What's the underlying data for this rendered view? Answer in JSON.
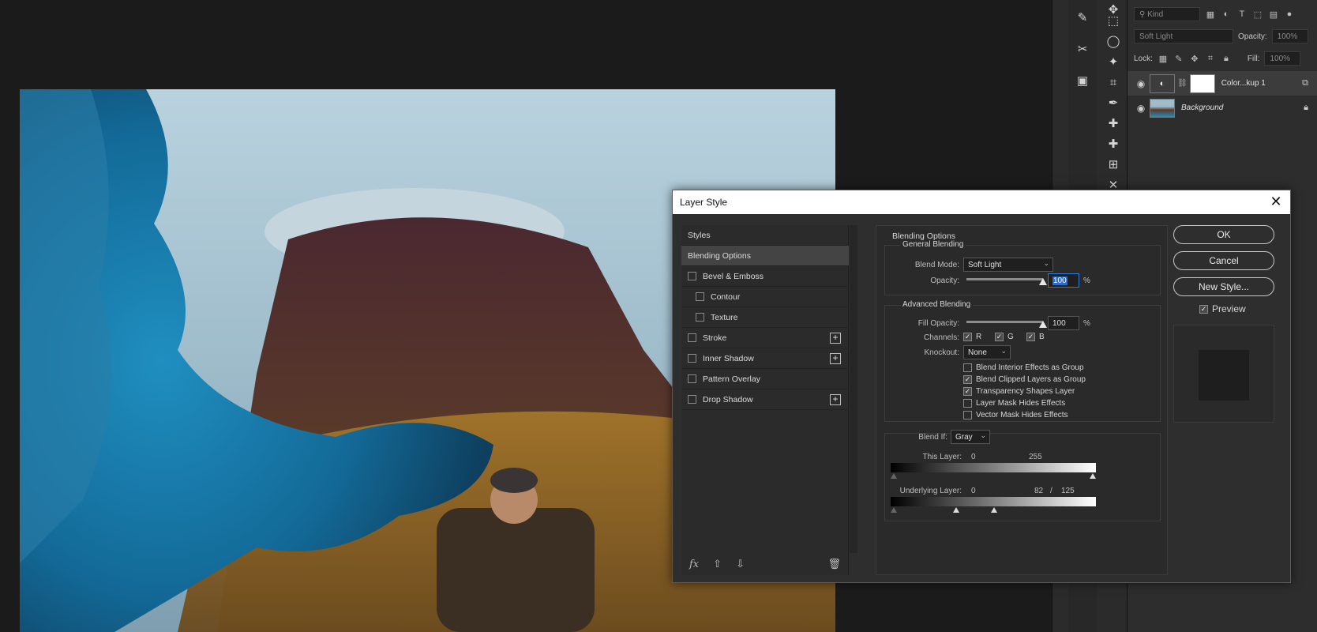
{
  "layers_panel": {
    "filter_kind": "Kind",
    "blend_mode": "Soft Light",
    "opacity_label": "Opacity:",
    "opacity_value": "100%",
    "lock_label": "Lock:",
    "fill_label": "Fill:",
    "fill_value": "100%",
    "layers": [
      {
        "name": "Color...kup 1",
        "selected": true
      },
      {
        "name": "Background",
        "selected": false
      }
    ]
  },
  "dialog": {
    "title": "Layer Style",
    "styles_list": [
      {
        "label": "Styles",
        "checkbox": false,
        "indent": false,
        "plus": false,
        "selected": false
      },
      {
        "label": "Blending Options",
        "checkbox": false,
        "indent": false,
        "plus": false,
        "selected": true
      },
      {
        "label": "Bevel & Emboss",
        "checkbox": true,
        "indent": false,
        "plus": false,
        "selected": false
      },
      {
        "label": "Contour",
        "checkbox": true,
        "indent": true,
        "plus": false,
        "selected": false
      },
      {
        "label": "Texture",
        "checkbox": true,
        "indent": true,
        "plus": false,
        "selected": false
      },
      {
        "label": "Stroke",
        "checkbox": true,
        "indent": false,
        "plus": true,
        "selected": false
      },
      {
        "label": "Inner Shadow",
        "checkbox": true,
        "indent": false,
        "plus": true,
        "selected": false
      },
      {
        "label": "Pattern Overlay",
        "checkbox": true,
        "indent": false,
        "plus": false,
        "selected": false
      },
      {
        "label": "Drop Shadow",
        "checkbox": true,
        "indent": false,
        "plus": true,
        "selected": false
      }
    ],
    "blending": {
      "section_title": "Blending Options",
      "general_title": "General Blending",
      "blend_mode_label": "Blend Mode:",
      "blend_mode_value": "Soft Light",
      "opacity_label": "Opacity:",
      "opacity_value": "100",
      "opacity_level": 1.0,
      "percent": "%",
      "advanced_title": "Advanced Blending",
      "fill_opacity_label": "Fill Opacity:",
      "fill_opacity_value": "100",
      "fill_opacity_level": 1.0,
      "channels_label": "Channels:",
      "channels": [
        {
          "label": "R",
          "checked": true
        },
        {
          "label": "G",
          "checked": true
        },
        {
          "label": "B",
          "checked": true
        }
      ],
      "knockout_label": "Knockout:",
      "knockout_value": "None",
      "options": [
        {
          "label": "Blend Interior Effects as Group",
          "checked": false
        },
        {
          "label": "Blend Clipped Layers as Group",
          "checked": true
        },
        {
          "label": "Transparency Shapes Layer",
          "checked": true
        },
        {
          "label": "Layer Mask Hides Effects",
          "checked": false
        },
        {
          "label": "Vector Mask Hides Effects",
          "checked": false
        }
      ],
      "blend_if_label": "Blend If:",
      "blend_if_value": "Gray",
      "this_layer_label": "This Layer:",
      "this_layer_min": "0",
      "this_layer_max": "255",
      "underlying_label": "Underlying Layer:",
      "underlying_min": "0",
      "underlying_split_low": "82",
      "underlying_slash": "/",
      "underlying_split_high": "125"
    },
    "buttons": {
      "ok": "OK",
      "cancel": "Cancel",
      "new_style": "New Style..."
    },
    "preview_label": "Preview",
    "preview_checked": true
  }
}
